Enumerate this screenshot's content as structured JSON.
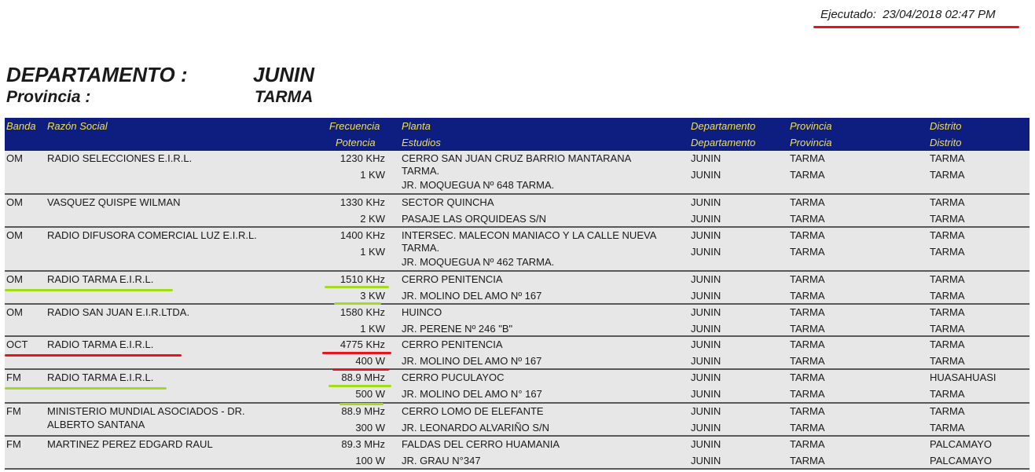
{
  "executed": "Ejecutado:  23/04/2018 02:47 PM",
  "header": {
    "dept_label": "DEPARTAMENTO :",
    "dept_value": "JUNIN",
    "prov_label": "Provincia :",
    "prov_value": "TARMA"
  },
  "columns": {
    "banda": "Banda",
    "razon": "Razón Social",
    "frecuencia": "Frecuencia",
    "potencia": "Potencia",
    "planta": "Planta",
    "estudios": "Estudios",
    "departamento1": "Departamento",
    "departamento2": "Departamento",
    "provincia1": "Provincia",
    "provincia2": "Provincia",
    "distrito1": "Distrito",
    "distrito2": "Distrito"
  },
  "rows": [
    {
      "banda": "OM",
      "razon1": "RADIO SELECCIONES E.I.R.L.",
      "razon2": "",
      "frecuencia": "1230 KHz",
      "potencia": "1 KW",
      "planta": "CERRO SAN JUAN CRUZ BARRIO MANTARANA",
      "planta2": "TARMA.",
      "estudios": "JR. MOQUEGUA Nº 648 TARMA.",
      "dep1": "JUNIN",
      "dep2": "JUNIN",
      "prov1": "TARMA",
      "prov2": "TARMA",
      "dist1": "TARMA",
      "dist2": "TARMA"
    },
    {
      "banda": "OM",
      "razon1": "VASQUEZ QUISPE WILMAN",
      "razon2": "",
      "frecuencia": "1330 KHz",
      "potencia": "2 KW",
      "planta": "SECTOR QUINCHA",
      "planta2": "",
      "estudios": "PASAJE LAS ORQUIDEAS S/N",
      "dep1": "JUNIN",
      "dep2": "JUNIN",
      "prov1": "TARMA",
      "prov2": "TARMA",
      "dist1": "TARMA",
      "dist2": "TARMA"
    },
    {
      "banda": "OM",
      "razon1": "RADIO DIFUSORA COMERCIAL LUZ E.I.R.L.",
      "razon2": "",
      "frecuencia": "1400 KHz",
      "potencia": "1 KW",
      "planta": "INTERSEC. MALECON MANIACO Y LA CALLE NUEVA",
      "planta2": "TARMA.",
      "estudios": "JR. MOQUEGUA Nº 462 TARMA.",
      "dep1": "JUNIN",
      "dep2": "JUNIN",
      "prov1": "TARMA",
      "prov2": "TARMA",
      "dist1": "TARMA",
      "dist2": "TARMA"
    },
    {
      "banda": "OM",
      "razon1": "RADIO TARMA E.I.R.L.",
      "razon2": "",
      "frecuencia": "1510 KHz",
      "potencia": "3 KW",
      "planta": "CERRO PENITENCIA",
      "planta2": "",
      "estudios": "JR. MOLINO DEL AMO Nº 167",
      "dep1": "JUNIN",
      "dep2": "JUNIN",
      "prov1": "TARMA",
      "prov2": "TARMA",
      "dist1": "TARMA",
      "dist2": "TARMA"
    },
    {
      "banda": "OM",
      "razon1": "RADIO SAN JUAN E.I.R.LTDA.",
      "razon2": "",
      "frecuencia": "1580 KHz",
      "potencia": "1 KW",
      "planta": "HUINCO",
      "planta2": "",
      "estudios": "JR. PERENE Nº 246 \"B\"",
      "dep1": "JUNIN",
      "dep2": "JUNIN",
      "prov1": "TARMA",
      "prov2": "TARMA",
      "dist1": "TARMA",
      "dist2": "TARMA"
    },
    {
      "banda": "OCT",
      "razon1": "RADIO TARMA E.I.R.L.",
      "razon2": "",
      "frecuencia": "4775 KHz",
      "potencia": "400 W",
      "planta": "CERRO PENITENCIA",
      "planta2": "",
      "estudios": "JR. MOLINO DEL AMO Nº 167",
      "dep1": "JUNIN",
      "dep2": "JUNIN",
      "prov1": "TARMA",
      "prov2": "TARMA",
      "dist1": "TARMA",
      "dist2": "TARMA"
    },
    {
      "banda": "FM",
      "razon1": "RADIO TARMA E.I.R.L.",
      "razon2": "",
      "frecuencia": "88.9 MHz",
      "potencia": "500 W",
      "planta": "CERRO PUCULAYOC",
      "planta2": "",
      "estudios": "JR. MOLINO DEL AMO N° 167",
      "dep1": "JUNIN",
      "dep2": "JUNIN",
      "prov1": "TARMA",
      "prov2": "TARMA",
      "dist1": "HUASAHUASI",
      "dist2": "TARMA"
    },
    {
      "banda": "FM",
      "razon1": "MINISTERIO MUNDIAL ASOCIADOS - DR.",
      "razon2": "ALBERTO SANTANA",
      "frecuencia": "88.9 MHz",
      "potencia": "300 W",
      "planta": "CERRO LOMO DE ELEFANTE",
      "planta2": "",
      "estudios": "JR. LEONARDO ALVARIÑO S/N",
      "dep1": "JUNIN",
      "dep2": "JUNIN",
      "prov1": "TARMA",
      "prov2": "TARMA",
      "dist1": "TARMA",
      "dist2": "TARMA"
    },
    {
      "banda": "FM",
      "razon1": "MARTINEZ PEREZ EDGARD RAUL",
      "razon2": "",
      "frecuencia": "89.3 MHz",
      "potencia": "100 W",
      "planta": "FALDAS DEL CERRO HUAMANIA",
      "planta2": "",
      "estudios": "JR. GRAU N°347",
      "dep1": "JUNIN",
      "dep2": "JUNIN",
      "prov1": "TARMA",
      "prov2": "TARMA",
      "dist1": "PALCAMAYO",
      "dist2": "PALCAMAYO"
    }
  ],
  "annotation_colors": {
    "highlight_green": "#a3dc1d",
    "highlight_red": "#e8141c",
    "header_bg": "#0d1d80",
    "header_text": "#f2e14a"
  }
}
